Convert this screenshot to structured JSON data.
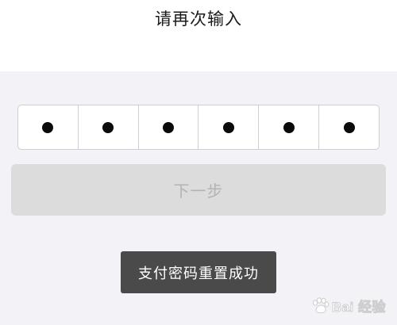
{
  "header": {
    "prompt": "请再次输入"
  },
  "pin": {
    "length": 6,
    "filled": 6
  },
  "actions": {
    "next_label": "下一步"
  },
  "toast": {
    "message": "支付密码重置成功"
  },
  "watermark": {
    "text": "Bai 经验"
  },
  "colors": {
    "background": "#f3f2f7",
    "button_disabled": "#dcdcdc",
    "toast_bg": "#4a4a4a"
  }
}
